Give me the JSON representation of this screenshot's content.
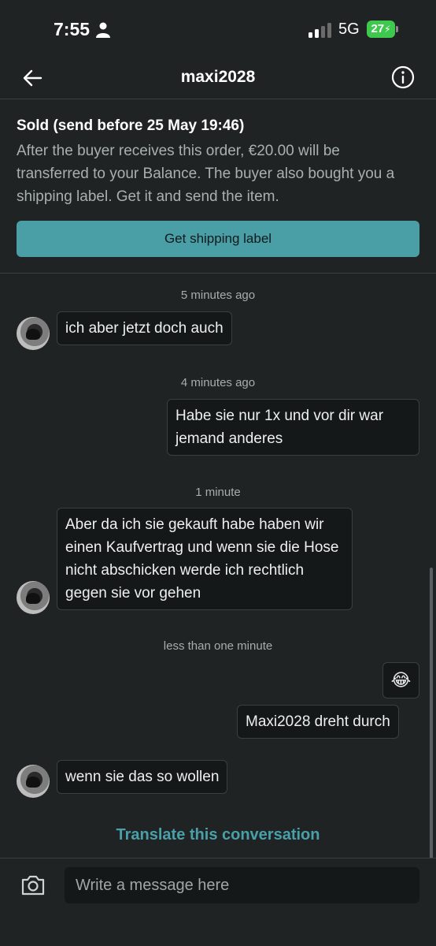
{
  "status_bar": {
    "time": "7:55",
    "network": "5G",
    "battery": "27"
  },
  "header": {
    "title": "maxi2028"
  },
  "order": {
    "title": "Sold (send before 25 May 19:46)",
    "description": "After the buyer receives this order, €20.00 will be transferred to your Balance. The buyer also bought you a shipping label. Get it and send the item.",
    "button_label": "Get shipping label"
  },
  "messages": {
    "ts1": "5 minutes ago",
    "m1": "ich aber jetzt doch auch",
    "ts2": "4 minutes ago",
    "m2": "Habe sie nur 1x und vor dir war jemand anderes",
    "ts3": "1 minute",
    "m3": "Aber da ich sie gekauft habe haben wir einen Kaufvertrag und wenn sie die Hose nicht abschicken werde ich rechtlich gegen sie vor gehen",
    "ts4": "less than one minute",
    "m4_emoji": "😂",
    "m5": "Maxi2028 dreht durch",
    "m6": "wenn sie das so wollen"
  },
  "translate_label": "Translate this conversation",
  "composer": {
    "placeholder": "Write a message here"
  },
  "colors": {
    "accent": "#4a9ea6",
    "background": "#1f2324",
    "bubble": "#151819"
  }
}
